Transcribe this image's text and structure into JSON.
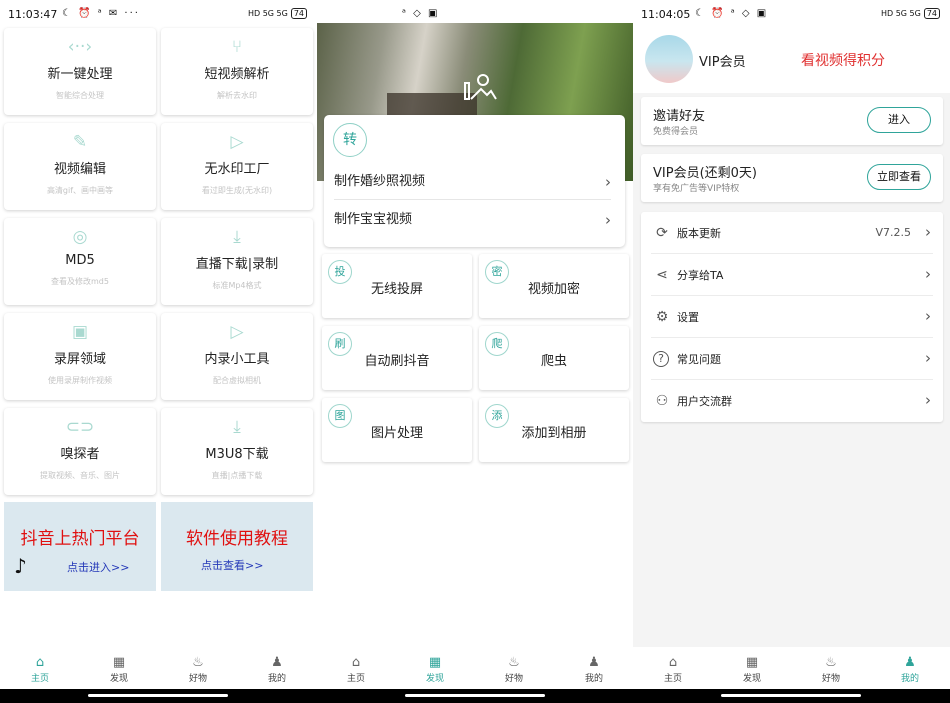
{
  "panel1": {
    "status": {
      "time": "11:03:47",
      "icons": "☾ ⏰ ᵃ ✉ ···",
      "right": "HD 5G 5G",
      "battery": "74"
    },
    "cards": [
      {
        "title": "新一键处理",
        "sub": "智能综合处理",
        "icon": "code-icon",
        "glyph": "‹··›"
      },
      {
        "title": "短视频解析",
        "sub": "解析去水印",
        "icon": "fork-icon",
        "glyph": "⑂"
      },
      {
        "title": "视频编辑",
        "sub": "高清gif、画中画等",
        "icon": "pencil-icon",
        "glyph": "✎"
      },
      {
        "title": "无水印工厂",
        "sub": "看过即生成(无水印)",
        "icon": "play-circle-icon",
        "glyph": "▷"
      },
      {
        "title": "MD5",
        "sub": "查看及修改md5",
        "icon": "target-icon",
        "glyph": "◎"
      },
      {
        "title": "直播下载|录制",
        "sub": "标准Mp4格式",
        "icon": "download-icon",
        "glyph": "⤓"
      },
      {
        "title": "录屏领域",
        "sub": "使用录屏制作视频",
        "icon": "video-add-icon",
        "glyph": "▣"
      },
      {
        "title": "内录小工具",
        "sub": "配合虚拟相机",
        "icon": "play-circle-icon",
        "glyph": "▷"
      },
      {
        "title": "嗅探者",
        "sub": "提取视频、音乐、图片",
        "icon": "link-icon",
        "glyph": "⊂⊃"
      },
      {
        "title": "M3U8下载",
        "sub": "直播|点播下载",
        "icon": "download-icon",
        "glyph": "⤓"
      }
    ],
    "promo_left": {
      "title": "抖音上热门平台",
      "link": "点击进入>>"
    },
    "promo_right": {
      "title": "软件使用教程",
      "link": "点击查看>>"
    }
  },
  "panel2": {
    "status": {
      "icons": "ᵃ ◇ ▣"
    },
    "zhuan": "转",
    "rows": [
      {
        "label": "制作婚纱照视频"
      },
      {
        "label": "制作宝宝视频"
      }
    ],
    "grid": [
      {
        "badge": "投",
        "label": "无线投屏"
      },
      {
        "badge": "密",
        "label": "视频加密"
      },
      {
        "badge": "刷",
        "label": "自动刷抖音"
      },
      {
        "badge": "爬",
        "label": "爬虫"
      },
      {
        "badge": "图",
        "label": "图片处理"
      },
      {
        "badge": "添",
        "label": "添加到相册"
      }
    ]
  },
  "panel3": {
    "status": {
      "time": "11:04:05",
      "icons": "☾ ⏰ ᵃ ◇ ▣",
      "right": "HD 5G 5G",
      "battery": "74"
    },
    "vip_name": "VIP会员",
    "earn": "看视频得积分",
    "invite": {
      "title": "邀请好友",
      "sub": "免费得会员",
      "button": "进入"
    },
    "vip": {
      "title": "VIP会员(还剩0天)",
      "sub": "享有免广告等VIP特权",
      "button": "立即查看"
    },
    "menu": [
      {
        "label": "版本更新",
        "value": "V7.2.5",
        "icon": "refresh-icon",
        "glyph": "⟳"
      },
      {
        "label": "分享给TA",
        "value": "",
        "icon": "share-icon",
        "glyph": "⋖"
      },
      {
        "label": "设置",
        "value": "",
        "icon": "gear-icon",
        "glyph": "⚙"
      },
      {
        "label": "常见问题",
        "value": "",
        "icon": "question-icon",
        "glyph": "?"
      },
      {
        "label": "用户交流群",
        "value": "",
        "icon": "group-icon",
        "glyph": "⚇"
      }
    ]
  },
  "tabs": [
    {
      "label": "主页",
      "glyph": "⌂",
      "icon": "home-icon"
    },
    {
      "label": "发现",
      "glyph": "▦",
      "icon": "grid-icon"
    },
    {
      "label": "好物",
      "glyph": "♨",
      "icon": "fire-icon"
    },
    {
      "label": "我的",
      "glyph": "♟",
      "icon": "bell-icon"
    }
  ],
  "colors": {
    "accent": "#2fa49a",
    "promo_red": "#e01010",
    "link_blue": "#2438b8"
  }
}
